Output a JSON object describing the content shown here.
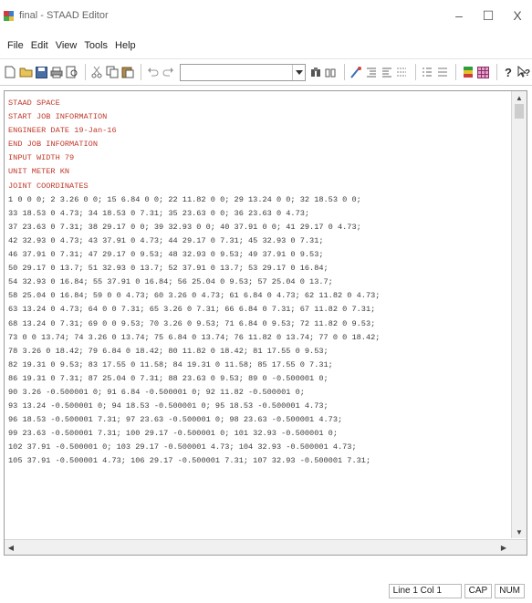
{
  "window": {
    "title": "final - STAAD Editor",
    "minimize": "–",
    "maximize": "☐",
    "close": "X"
  },
  "menu": [
    "File",
    "Edit",
    "View",
    "Tools",
    "Help"
  ],
  "toolbar": {
    "combo_value": ""
  },
  "editor": {
    "lines": [
      {
        "text": "STAAD SPACE",
        "kind": "kw"
      },
      {
        "text": "START JOB INFORMATION",
        "kind": "kw"
      },
      {
        "text": "ENGINEER DATE 19-Jan-16",
        "kind": "kw"
      },
      {
        "text": "END JOB INFORMATION",
        "kind": "kw"
      },
      {
        "text": "INPUT WIDTH 79",
        "kind": "kw"
      },
      {
        "text": "UNIT METER KN",
        "kind": "kw"
      },
      {
        "text": "JOINT COORDINATES",
        "kind": "kw"
      },
      {
        "text": "1 0 0 0; 2 3.26 0 0; 15 6.84 0 0; 22 11.82 0 0; 29 13.24 0 0; 32 18.53 0 0;",
        "kind": "num"
      },
      {
        "text": "33 18.53 0 4.73; 34 18.53 0 7.31; 35 23.63 0 0; 36 23.63 0 4.73;",
        "kind": "num"
      },
      {
        "text": "37 23.63 0 7.31; 38 29.17 0 0; 39 32.93 0 0; 40 37.91 0 0; 41 29.17 0 4.73;",
        "kind": "num"
      },
      {
        "text": "42 32.93 0 4.73; 43 37.91 0 4.73; 44 29.17 0 7.31; 45 32.93 0 7.31;",
        "kind": "num"
      },
      {
        "text": "46 37.91 0 7.31; 47 29.17 0 9.53; 48 32.93 0 9.53; 49 37.91 0 9.53;",
        "kind": "num"
      },
      {
        "text": "50 29.17 0 13.7; 51 32.93 0 13.7; 52 37.91 0 13.7; 53 29.17 0 16.84;",
        "kind": "num"
      },
      {
        "text": "54 32.93 0 16.84; 55 37.91 0 16.84; 56 25.04 0 9.53; 57 25.04 0 13.7;",
        "kind": "num"
      },
      {
        "text": "58 25.04 0 16.84; 59 0 0 4.73; 60 3.26 0 4.73; 61 6.84 0 4.73; 62 11.82 0 4.73;",
        "kind": "num"
      },
      {
        "text": "63 13.24 0 4.73; 64 0 0 7.31; 65 3.26 0 7.31; 66 6.84 0 7.31; 67 11.82 0 7.31;",
        "kind": "num"
      },
      {
        "text": "68 13.24 0 7.31; 69 0 0 9.53; 70 3.26 0 9.53; 71 6.84 0 9.53; 72 11.82 0 9.53;",
        "kind": "num"
      },
      {
        "text": "73 0 0 13.74; 74 3.26 0 13.74; 75 6.84 0 13.74; 76 11.82 0 13.74; 77 0 0 18.42;",
        "kind": "num"
      },
      {
        "text": "78 3.26 0 18.42; 79 6.84 0 18.42; 80 11.82 0 18.42; 81 17.55 0 9.53;",
        "kind": "num"
      },
      {
        "text": "82 19.31 0 9.53; 83 17.55 0 11.58; 84 19.31 0 11.58; 85 17.55 0 7.31;",
        "kind": "num"
      },
      {
        "text": "86 19.31 0 7.31; 87 25.04 0 7.31; 88 23.63 0 9.53; 89 0 -0.500001 0;",
        "kind": "num"
      },
      {
        "text": "90 3.26 -0.500001 0; 91 6.84 -0.500001 0; 92 11.82 -0.500001 0;",
        "kind": "num"
      },
      {
        "text": "93 13.24 -0.500001 0; 94 18.53 -0.500001 0; 95 18.53 -0.500001 4.73;",
        "kind": "num"
      },
      {
        "text": "96 18.53 -0.500001 7.31; 97 23.63 -0.500001 0; 98 23.63 -0.500001 4.73;",
        "kind": "num"
      },
      {
        "text": "99 23.63 -0.500001 7.31; 100 29.17 -0.500001 0; 101 32.93 -0.500001 0;",
        "kind": "num"
      },
      {
        "text": "102 37.91 -0.500001 0; 103 29.17 -0.500001 4.73; 104 32.93 -0.500001 4.73;",
        "kind": "num"
      },
      {
        "text": "105 37.91 -0.500001 4.73; 106 29.17 -0.500001 7.31; 107 32.93 -0.500001 7.31;",
        "kind": "num"
      }
    ]
  },
  "status": {
    "position": "Line 1 Col 1",
    "caps": "CAP",
    "num": "NUM"
  },
  "icons": [
    "new-file-icon",
    "open-file-icon",
    "save-icon",
    "print-icon",
    "print-preview-icon",
    "cut-icon",
    "copy-icon",
    "paste-icon",
    "undo-icon",
    "redo-icon",
    "find-icon",
    "find-next-icon",
    "run-icon",
    "indent-icon",
    "outdent-icon",
    "comment-icon",
    "list-icon",
    "list2-icon",
    "color-icon",
    "grid-icon",
    "help-icon",
    "context-help-icon"
  ]
}
